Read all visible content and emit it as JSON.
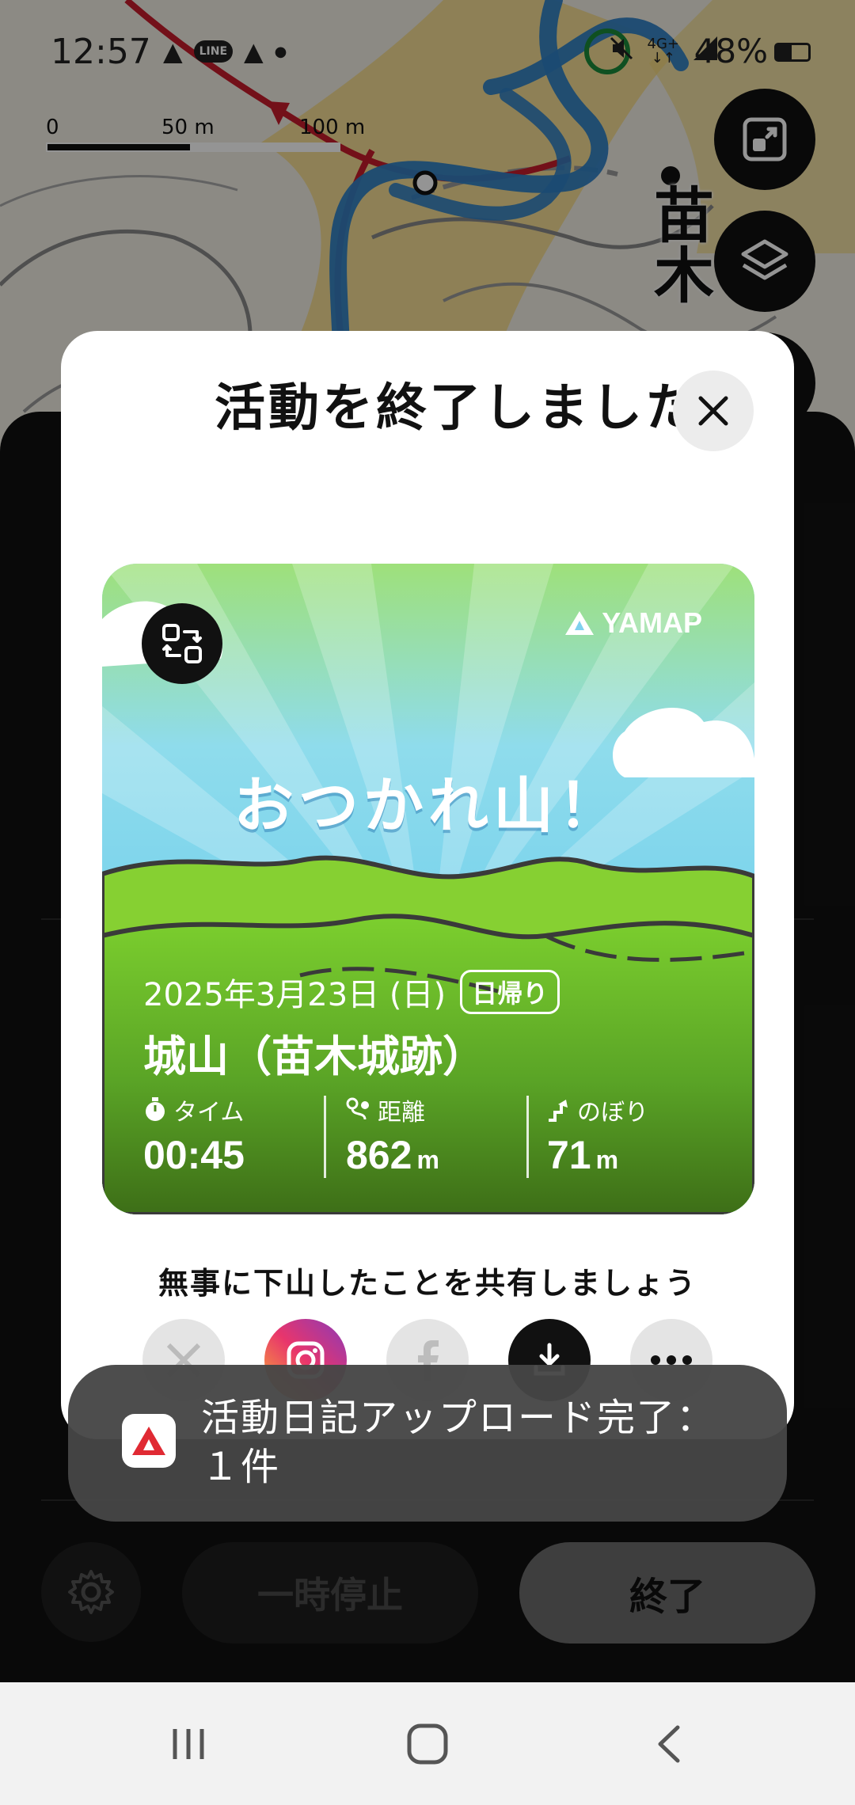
{
  "status_bar": {
    "time": "12:57",
    "battery": "48%",
    "network": "4G+",
    "left_icons": [
      "yamap-notification-icon",
      "line-icon",
      "yamap-notification-icon",
      "dot-icon"
    ],
    "line_badge": "LINE"
  },
  "map": {
    "scale_labels": [
      "0",
      "50 m",
      "100 m"
    ],
    "place_label": "苗木",
    "buttons": [
      "recenter-icon",
      "layers-icon"
    ]
  },
  "dialog": {
    "title": "活動を終了しました",
    "card": {
      "brand": "YAMAP",
      "headline": "おつかれ山！",
      "date": "2025年3月23日 (日)",
      "tag": "日帰り",
      "place": "城山（苗木城跡）",
      "stats": [
        {
          "label": "タイム",
          "value": "00:45",
          "unit": "",
          "icon": "stopwatch-icon"
        },
        {
          "label": "距離",
          "value": "862",
          "unit": "m",
          "icon": "route-icon"
        },
        {
          "label": "のぼり",
          "value": "71",
          "unit": "m",
          "icon": "ascent-icon"
        }
      ]
    },
    "share_text": "無事に下山したことを共有しましょう",
    "share_buttons": [
      "x-icon",
      "instagram-icon",
      "facebook-icon",
      "download-icon",
      "more-icon"
    ]
  },
  "toast": {
    "text": "活動日記アップロード完了：１件"
  },
  "bottom_actions": {
    "pause_label": "一時停止",
    "finish_label": "終了"
  },
  "colors": {
    "route_blue": "#2f7fc4",
    "route_red": "#c61d2b",
    "map_yellow": "#f3d870",
    "card_green": "#6cbf2b",
    "sky_blue": "#7fd0ee",
    "yamap_red": "#e02a33"
  }
}
